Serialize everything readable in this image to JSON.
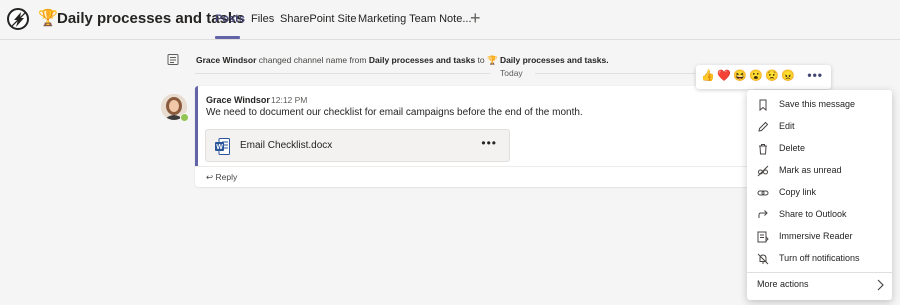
{
  "header": {
    "title": "Daily processes and tasks",
    "title_emoji": "🏆",
    "tabs": [
      {
        "label": "Posts",
        "active": true
      },
      {
        "label": "Files",
        "active": false
      },
      {
        "label": "SharePoint Site",
        "active": false
      },
      {
        "label": "Marketing Team Note...",
        "active": false
      }
    ],
    "add_tab_icon": "+"
  },
  "system_message": {
    "actor": "Grace Windsor",
    "action": " changed channel name from ",
    "old_name": "Daily processes and tasks",
    "to": " to ",
    "new_emoji": "🏆",
    "new_name": " Daily processes and tasks."
  },
  "date_divider": "Today",
  "message": {
    "author": "Grace Windsor",
    "time": "12:12 PM",
    "text": "We need to document our checklist for email campaigns before the end of the month.",
    "attachment": {
      "name": "Email Checklist.docx",
      "more_icon": "•••"
    },
    "reply_icon": "↩",
    "reply_label": "Reply"
  },
  "reactions": [
    "👍",
    "❤️",
    "😆",
    "😮",
    "😟",
    "😠"
  ],
  "reaction_more": "•••",
  "context_menu": {
    "items": [
      {
        "label": "Save this message",
        "icon": "bookmark-icon"
      },
      {
        "label": "Edit",
        "icon": "pencil-icon"
      },
      {
        "label": "Delete",
        "icon": "trash-icon"
      },
      {
        "label": "Mark as unread",
        "icon": "glasses-off-icon"
      },
      {
        "label": "Copy link",
        "icon": "link-icon"
      },
      {
        "label": "Share to Outlook",
        "icon": "share-icon"
      },
      {
        "label": "Immersive Reader",
        "icon": "reader-icon"
      },
      {
        "label": "Turn off notifications",
        "icon": "bell-off-icon"
      }
    ],
    "more_actions": "More actions"
  },
  "colors": {
    "accent": "#6264a7",
    "presence": "#92c353",
    "word": "#2b579a"
  }
}
